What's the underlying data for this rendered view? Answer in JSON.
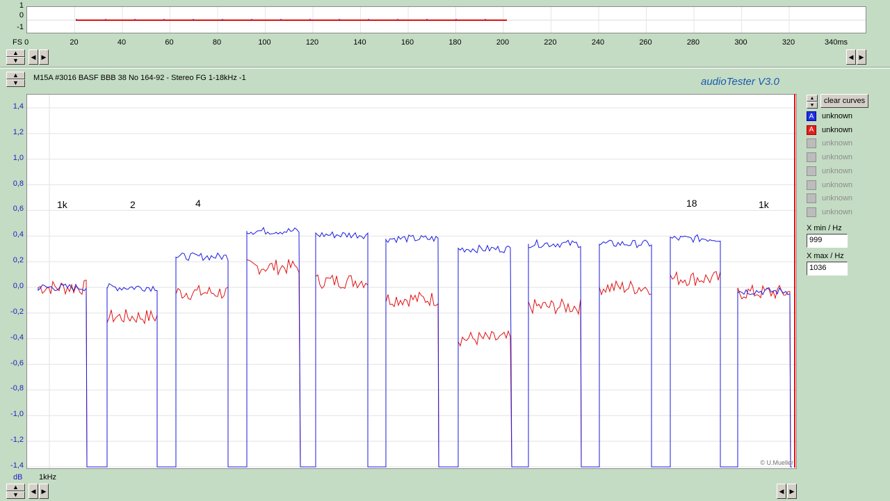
{
  "overview": {
    "y_labels": [
      "1",
      "0",
      "-1"
    ],
    "x_labels": [
      "FS 0",
      "20",
      "40",
      "60",
      "80",
      "100",
      "120",
      "140",
      "160",
      "180",
      "200",
      "220",
      "240",
      "260",
      "280",
      "300",
      "320",
      "340ms"
    ]
  },
  "header": {
    "title": "M15A #3016 BASF BBB 38 No 164-92 - Stereo FG 1-18kHz -1",
    "app_name": "audioTester  V3.0"
  },
  "main_plot": {
    "y_labels": [
      "1,4",
      "1,2",
      "1,0",
      "0,8",
      "0,6",
      "0,4",
      "0,2",
      "0,0",
      "-0,2",
      "-0,4",
      "-0,6",
      "-0,8",
      "-1,0",
      "-1,2",
      "-1,4"
    ],
    "unit_label": "dB",
    "x_label": "1kHz",
    "annotations": [
      "1k",
      "2",
      "4",
      "18",
      "1k"
    ],
    "credit": "© U.Mueller"
  },
  "legend": {
    "clear_label": "clear curves",
    "items": [
      {
        "label": "unknown",
        "state": "blue",
        "glyph": "A"
      },
      {
        "label": "unknown",
        "state": "red",
        "glyph": "A"
      },
      {
        "label": "unknown",
        "state": "off",
        "glyph": ""
      },
      {
        "label": "unknown",
        "state": "off",
        "glyph": ""
      },
      {
        "label": "unknown",
        "state": "off",
        "glyph": ""
      },
      {
        "label": "unknown",
        "state": "off",
        "glyph": ""
      },
      {
        "label": "unknown",
        "state": "off",
        "glyph": ""
      },
      {
        "label": "unknown",
        "state": "off",
        "glyph": ""
      }
    ]
  },
  "xmin": {
    "label": "X min / Hz",
    "value": "999"
  },
  "xmax": {
    "label": "X max / Hz",
    "value": "1036"
  },
  "colors": {
    "blue": "#1a1ae0",
    "red": "#e01010",
    "axis_blue": "#2020c0"
  },
  "chart_data": {
    "type": "line",
    "x_unit": "segment",
    "y_unit": "dB",
    "ylim": [
      -1.4,
      1.4
    ],
    "segments": [
      {
        "label": "1k",
        "blue": 0.0,
        "red": 0.0
      },
      {
        "label": "2",
        "blue": 0.0,
        "red": -0.23
      },
      {
        "label": "4",
        "blue": 0.24,
        "red": -0.04
      },
      {
        "label": "",
        "blue": 0.44,
        "red": 0.16
      },
      {
        "label": "",
        "blue": 0.41,
        "red": 0.05
      },
      {
        "label": "",
        "blue": 0.38,
        "red": -0.09
      },
      {
        "label": "",
        "blue": 0.3,
        "red": -0.4
      },
      {
        "label": "",
        "blue": 0.34,
        "red": -0.15
      },
      {
        "label": "",
        "blue": 0.34,
        "red": 0.0
      },
      {
        "label": "18",
        "blue": 0.38,
        "red": 0.07
      },
      {
        "label": "1k",
        "blue": -0.03,
        "red": -0.04
      }
    ]
  }
}
